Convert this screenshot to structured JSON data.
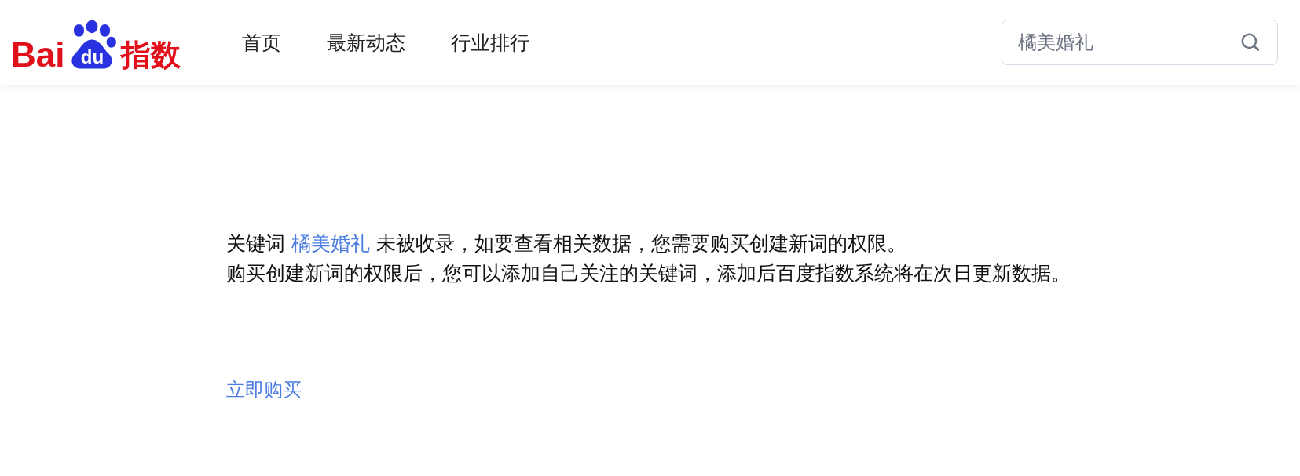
{
  "logo": {
    "left": "Bai",
    "paw": "du",
    "right": "指数"
  },
  "nav": [
    {
      "label": "首页",
      "selected": false
    },
    {
      "label": "最新动态",
      "selected": false
    },
    {
      "label": "行业排行",
      "selected": false
    }
  ],
  "search": {
    "value": "橘美婚礼"
  },
  "message": {
    "prefix": "关键词",
    "keyword": "橘美婚礼",
    "suffix": "未被收录，如要查看相关数据，您需要购买创建新词的权限。",
    "line_2": "购买创建新词的权限后，您可以添加自己关注的关键词，添加后百度指数系统将在次日更新数据。"
  },
  "buy_link": "立即购买"
}
